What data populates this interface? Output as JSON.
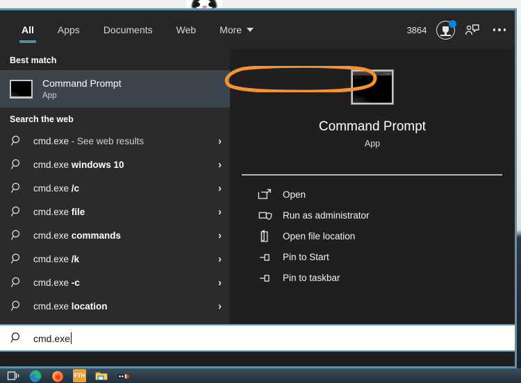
{
  "window": {
    "accent_border": "#5f93ab",
    "header_bg": "#262626",
    "results_bg": "#2b2b2b",
    "details_bg": "#1f1f1f",
    "selected_row_bg": "#3c444c",
    "tab_underline": "#5a8a9e",
    "annotation_color": "#f59331"
  },
  "header": {
    "tabs": [
      {
        "label": "All",
        "active": true
      },
      {
        "label": "Apps",
        "active": false
      },
      {
        "label": "Documents",
        "active": false
      },
      {
        "label": "Web",
        "active": false
      },
      {
        "label": "More",
        "active": false,
        "caret": true
      }
    ],
    "rewards_count": "3864",
    "rewards_icon": "trophy-badge-icon",
    "rewards_notification_dot": "#0a84e0",
    "feedback_icon": "feedback-person-icon",
    "more_icon": "ellipsis-icon"
  },
  "results": {
    "best_match_label": "Best match",
    "best_match": {
      "title": "Command Prompt",
      "subtitle": "App",
      "icon": "command-prompt-icon",
      "selected": true
    },
    "web_label": "Search the web",
    "web_items": [
      {
        "prefix": "cmd.exe",
        "suffix": " - See web results",
        "bold": false
      },
      {
        "prefix": "cmd.exe ",
        "suffix": "windows 10",
        "bold": true
      },
      {
        "prefix": "cmd.exe ",
        "suffix": "/c",
        "bold": true
      },
      {
        "prefix": "cmd.exe ",
        "suffix": "file",
        "bold": true
      },
      {
        "prefix": "cmd.exe ",
        "suffix": "commands",
        "bold": true
      },
      {
        "prefix": "cmd.exe ",
        "suffix": "/k",
        "bold": true
      },
      {
        "prefix": "cmd.exe ",
        "suffix": "-c",
        "bold": true
      },
      {
        "prefix": "cmd.exe ",
        "suffix": "location",
        "bold": true
      }
    ],
    "chevron": "›"
  },
  "details": {
    "app_title": "Command Prompt",
    "app_subtitle": "App",
    "app_icon": "command-prompt-icon",
    "icon_prompt_text": "C:\\>",
    "actions": [
      {
        "label": "Open",
        "icon": "open-window-icon"
      },
      {
        "label": "Run as administrator",
        "icon": "shield-window-icon",
        "highlighted": true
      },
      {
        "label": "Open file location",
        "icon": "folder-open-icon"
      },
      {
        "label": "Pin to Start",
        "icon": "pin-icon"
      },
      {
        "label": "Pin to taskbar",
        "icon": "pin-icon"
      }
    ]
  },
  "search": {
    "value": "cmd.exe",
    "icon": "search-icon"
  },
  "taskbar": {
    "items": [
      {
        "name": "task-view",
        "label": "Task View"
      },
      {
        "name": "edge",
        "label": "Microsoft Edge"
      },
      {
        "name": "firefox",
        "label": "Firefox"
      },
      {
        "name": "fth",
        "label": "FTH"
      },
      {
        "name": "file-explorer",
        "label": "File Explorer"
      },
      {
        "name": "tool",
        "label": "Tool"
      }
    ],
    "fth_label": "FTH"
  }
}
